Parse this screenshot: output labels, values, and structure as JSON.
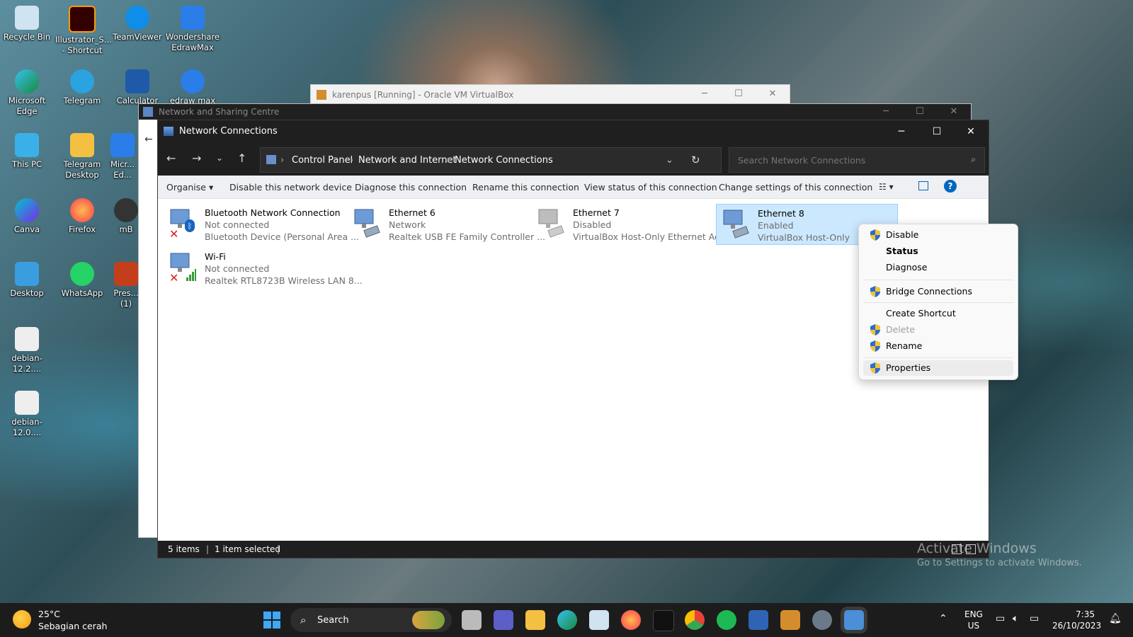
{
  "desktop": {
    "icons": [
      {
        "label": "Recycle Bin"
      },
      {
        "label": "Illustrator_S... - Shortcut"
      },
      {
        "label": "TeamViewer"
      },
      {
        "label": "Wondershare EdrawMax"
      },
      {
        "label": "Microsoft Edge"
      },
      {
        "label": "Telegram"
      },
      {
        "label": "Calculator"
      },
      {
        "label": "edraw max"
      },
      {
        "label": "This PC"
      },
      {
        "label": "Telegram Desktop"
      },
      {
        "label": "Micr... Ed..."
      },
      {
        "label": "Canva"
      },
      {
        "label": "Firefox"
      },
      {
        "label": "mB"
      },
      {
        "label": "Desktop"
      },
      {
        "label": "WhatsApp"
      },
      {
        "label": "Pres... (1)"
      },
      {
        "label": "debian-12.2...."
      },
      {
        "label": "debian-12.0...."
      }
    ]
  },
  "vbox_window": {
    "title": "karenpus [Running] - Oracle VM VirtualBox"
  },
  "nsc_window": {
    "title": "Network and Sharing Centre"
  },
  "window": {
    "title": "Network Connections",
    "breadcrumb": [
      "Control Panel",
      "Network and Internet",
      "Network Connections"
    ],
    "search_placeholder": "Search Network Connections"
  },
  "commands": {
    "organise": "Organise",
    "disable": "Disable this network device",
    "diagnose": "Diagnose this connection",
    "rename": "Rename this connection",
    "view_status": "View status of this connection",
    "change_settings": "Change settings of this connection"
  },
  "connections": [
    {
      "name": "Bluetooth Network Connection",
      "status": "Not connected",
      "device": "Bluetooth Device (Personal Area ..."
    },
    {
      "name": "Ethernet 6",
      "status": "Network",
      "device": "Realtek USB FE Family Controller ..."
    },
    {
      "name": "Ethernet 7",
      "status": "Disabled",
      "device": "VirtualBox Host-Only Ethernet Ad..."
    },
    {
      "name": "Ethernet 8",
      "status": "Enabled",
      "device": "VirtualBox Host-Only",
      "selected": true
    },
    {
      "name": "Wi-Fi",
      "status": "Not connected",
      "device": "Realtek RTL8723B Wireless LAN 8..."
    }
  ],
  "status_bar": {
    "items": "5 items",
    "selected": "1 item selected"
  },
  "context_menu": {
    "items": [
      {
        "label": "Disable",
        "shield": true
      },
      {
        "label": "Status",
        "bold": true
      },
      {
        "label": "Diagnose"
      },
      {
        "label": "Bridge Connections",
        "shield": true
      },
      {
        "label": "Create Shortcut"
      },
      {
        "label": "Delete",
        "shield": true,
        "disabled": true
      },
      {
        "label": "Rename",
        "shield": true
      },
      {
        "label": "Properties",
        "shield": true,
        "hover": true
      }
    ]
  },
  "watermark": {
    "line1": "Activate Windows",
    "line2": "Go to Settings to activate Windows."
  },
  "taskbar": {
    "weather_temp": "25°C",
    "weather_desc": "Sebagian cerah",
    "search_label": "Search",
    "lang1": "ENG",
    "lang2": "US",
    "time": "7:35",
    "date": "26/10/2023"
  },
  "colors": {
    "accent": "#0067c0",
    "selection": "#cce8ff",
    "titlebar": "#1f1f1f"
  }
}
